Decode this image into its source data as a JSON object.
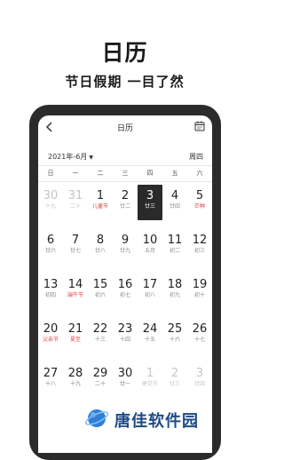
{
  "promo": {
    "title": "日历",
    "subtitle": "节日假期  一目了然"
  },
  "app": {
    "nav_title": "日历",
    "back_icon": "back-chevron-icon",
    "calendar_icon": "calendar-icon",
    "month_label": "2021年-6月",
    "week_toggle_label": "周四"
  },
  "weekdays": [
    "日",
    "一",
    "二",
    "三",
    "四",
    "五",
    "六"
  ],
  "weeks": [
    [
      {
        "n": "30",
        "s": "十九",
        "dim": true
      },
      {
        "n": "31",
        "s": "二十",
        "dim": true
      },
      {
        "n": "1",
        "s": "儿童节",
        "holiday": true
      },
      {
        "n": "2",
        "s": "廿二"
      },
      {
        "n": "3",
        "s": "廿三",
        "selected": true
      },
      {
        "n": "4",
        "s": "廿四"
      },
      {
        "n": "5",
        "s": "芒种",
        "holiday": true
      }
    ],
    [
      {
        "n": "6",
        "s": "廿六"
      },
      {
        "n": "7",
        "s": "廿七"
      },
      {
        "n": "8",
        "s": "廿八"
      },
      {
        "n": "9",
        "s": "廿九"
      },
      {
        "n": "10",
        "s": "五月"
      },
      {
        "n": "11",
        "s": "初二"
      },
      {
        "n": "12",
        "s": "初三"
      }
    ],
    [
      {
        "n": "13",
        "s": "初四"
      },
      {
        "n": "14",
        "s": "端午节",
        "holiday": true
      },
      {
        "n": "15",
        "s": "初六"
      },
      {
        "n": "16",
        "s": "初七"
      },
      {
        "n": "17",
        "s": "初八"
      },
      {
        "n": "18",
        "s": "初九"
      },
      {
        "n": "19",
        "s": "初十"
      }
    ],
    [
      {
        "n": "20",
        "s": "父亲节",
        "holiday": true
      },
      {
        "n": "21",
        "s": "夏至",
        "holiday": true
      },
      {
        "n": "22",
        "s": "十三"
      },
      {
        "n": "23",
        "s": "十四"
      },
      {
        "n": "24",
        "s": "十五"
      },
      {
        "n": "25",
        "s": "十六"
      },
      {
        "n": "26",
        "s": "十七"
      }
    ],
    [
      {
        "n": "27",
        "s": "十八"
      },
      {
        "n": "28",
        "s": "十九"
      },
      {
        "n": "29",
        "s": "二十"
      },
      {
        "n": "30",
        "s": "廿一"
      },
      {
        "n": "1",
        "s": "建党节",
        "dim": true
      },
      {
        "n": "2",
        "s": "廿三",
        "dim": true
      },
      {
        "n": "3",
        "s": "廿四",
        "dim": true
      }
    ]
  ],
  "watermark": {
    "text": "唐佳软件园",
    "logo_icon": "planet-logo-icon"
  },
  "colors": {
    "holiday": "#e83a3a",
    "selected_bg": "#2a2a2a",
    "phone_frame": "#2b2b2b",
    "watermark": "#1d4a86"
  }
}
